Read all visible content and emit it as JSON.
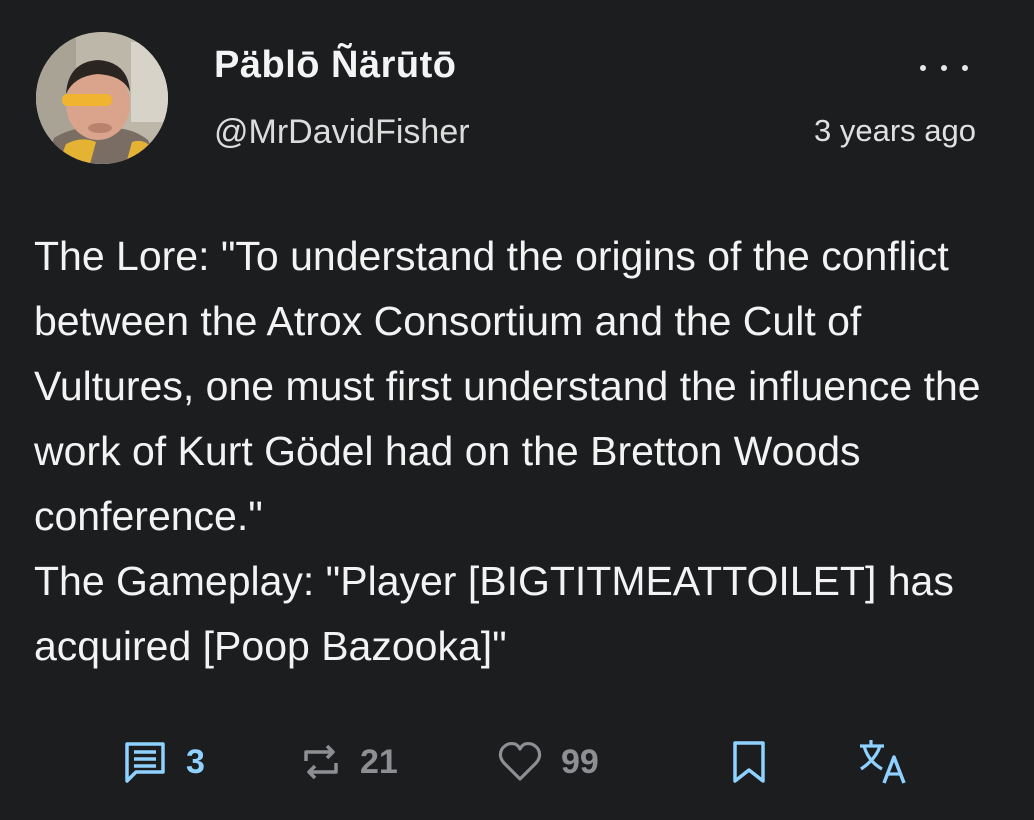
{
  "post": {
    "author": {
      "display_name": "Päblō Ñärūtō",
      "handle": "@MrDavidFisher"
    },
    "timestamp": "3 years ago",
    "body": [
      "The Lore: \"To understand the origins of the conflict between the Atrox Consortium and the Cult of Vultures, one must first understand the influence the work of Kurt Gödel had on the Bretton Woods conference.\"",
      "The Gameplay: \"Player [BIGTITMEATTOILET] has acquired [Poop Bazooka]\""
    ],
    "actions": {
      "replies": "3",
      "reposts": "21",
      "likes": "99"
    }
  },
  "icons": {
    "reply": "comment-icon",
    "repost": "repost-icon",
    "like": "heart-icon",
    "bookmark": "bookmark-icon",
    "translate": "translate-icon",
    "more": "more-horizontal-icon"
  },
  "colors": {
    "background": "#1c1d1f",
    "text": "#f3f3f3",
    "accent": "#8fd1ff",
    "muted": "#8d8f93"
  }
}
